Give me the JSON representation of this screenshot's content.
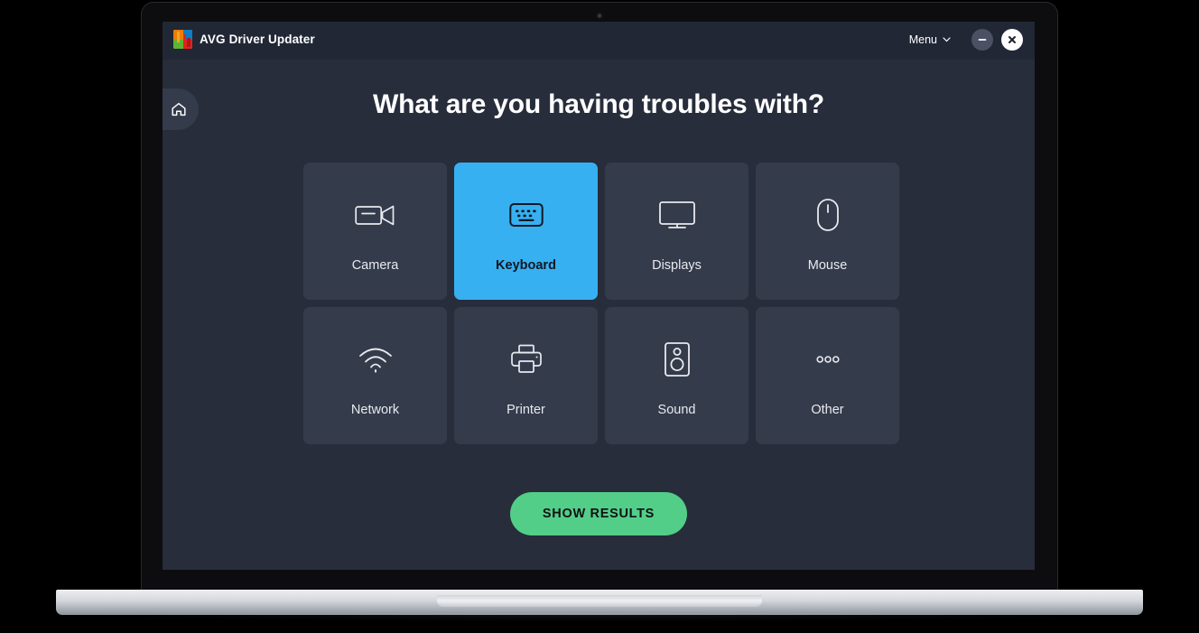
{
  "titlebar": {
    "brand_avg": "AVG",
    "brand_product": "Driver Updater",
    "menu_label": "Menu",
    "minimize_label": "",
    "close_label": ""
  },
  "nav": {
    "home_label": ""
  },
  "main": {
    "page_title": "What are you having troubles with?",
    "tiles": [
      {
        "label": "Camera",
        "icon": "camera-icon",
        "selected": false
      },
      {
        "label": "Keyboard",
        "icon": "keyboard-icon",
        "selected": true
      },
      {
        "label": "Displays",
        "icon": "display-icon",
        "selected": false
      },
      {
        "label": "Mouse",
        "icon": "mouse-icon",
        "selected": false
      },
      {
        "label": "Network",
        "icon": "wifi-icon",
        "selected": false
      },
      {
        "label": "Printer",
        "icon": "printer-icon",
        "selected": false
      },
      {
        "label": "Sound",
        "icon": "speaker-icon",
        "selected": false
      },
      {
        "label": "Other",
        "icon": "ellipsis-icon",
        "selected": false
      }
    ],
    "primary_action": "SHOW RESULTS"
  },
  "colors": {
    "app_background": "#272d3b",
    "titlebar": "#212735",
    "tile": "#343b4b",
    "tile_selected": "#37b0f1",
    "action_green": "#52ce89",
    "text_primary": "#ffffff",
    "text_on_selected": "#101822"
  }
}
